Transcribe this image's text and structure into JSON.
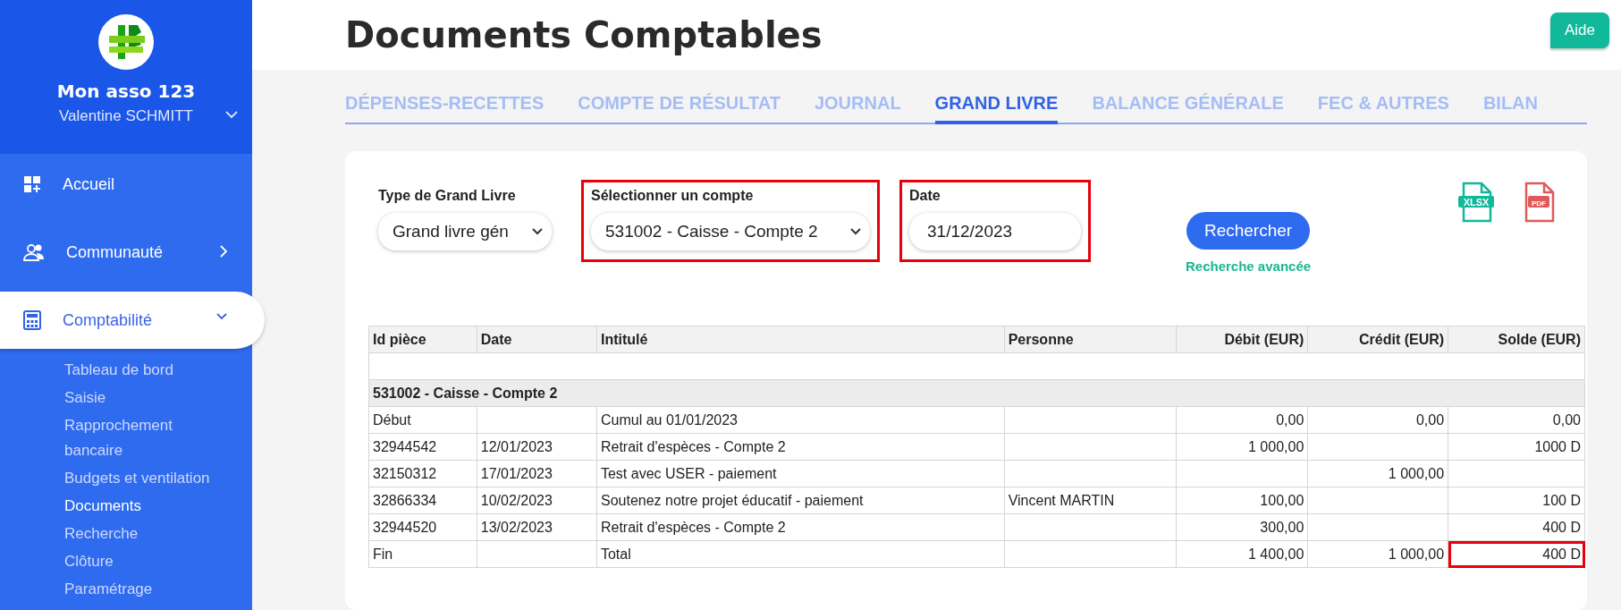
{
  "sidebar": {
    "org_name": "Mon asso 123",
    "user_name": "Valentine SCHMITT",
    "menu": [
      {
        "kind": "link",
        "label": "Accueil",
        "selected": false
      },
      {
        "kind": "group",
        "label": "Communauté",
        "expanded": false,
        "selected": false
      },
      {
        "kind": "group",
        "label": "Comptabilité",
        "expanded": true,
        "selected": true
      }
    ],
    "submenu": [
      {
        "label": "Tableau de bord",
        "selected": false
      },
      {
        "label": "Saisie",
        "selected": false
      },
      {
        "label": "Rapprochement bancaire",
        "selected": false
      },
      {
        "label": "Budgets et ventilation",
        "selected": false
      },
      {
        "label": "Documents",
        "selected": true
      },
      {
        "label": "Recherche",
        "selected": false
      },
      {
        "label": "Clôture",
        "selected": false
      },
      {
        "label": "Paramétrage",
        "selected": false
      }
    ]
  },
  "page_title": "Documents Comptables",
  "help_button": "Aide",
  "tabs": [
    {
      "label": "DÉPENSES-RECETTES",
      "selected": false
    },
    {
      "label": "COMPTE DE RÉSULTAT",
      "selected": false
    },
    {
      "label": "JOURNAL",
      "selected": false
    },
    {
      "label": "GRAND LIVRE",
      "selected": true
    },
    {
      "label": "BALANCE GÉNÉRALE",
      "selected": false
    },
    {
      "label": "FEC & AUTRES",
      "selected": false
    },
    {
      "label": "BILAN",
      "selected": false
    }
  ],
  "filters": [
    {
      "kind": "select",
      "label": "Type de Grand Livre",
      "value": "Grand livre gén",
      "highlighted": false
    },
    {
      "kind": "select",
      "label": "Sélectionner un compte",
      "value": "531002 - Caisse - Compte 2",
      "highlighted": true
    },
    {
      "kind": "date",
      "label": "Date",
      "value": "31/12/2023",
      "highlighted": true
    }
  ],
  "search_button": "Rechercher",
  "advanced_search_link": "Recherche avancée",
  "export_buttons": [
    {
      "kind": "xlsx",
      "label": "XLSX"
    },
    {
      "kind": "pdf",
      "label": "PDF"
    }
  ],
  "table": {
    "columns": [
      "Id pièce",
      "Date",
      "Intitulé",
      "Personne",
      "Débit (EUR)",
      "Crédit (EUR)",
      "Solde (EUR)"
    ],
    "rows": [
      {
        "kind": "group",
        "label": "531002 - Caisse - Compte 2"
      },
      {
        "kind": "data",
        "cells": [
          "Début",
          "",
          "Cumul au 01/01/2023",
          "",
          "0,00",
          "0,00",
          "0,00"
        ],
        "solde_highlighted": false
      },
      {
        "kind": "data",
        "cells": [
          "32944542",
          "12/01/2023",
          "Retrait d'espèces - Compte 2",
          "",
          "1 000,00",
          "",
          "1000 D"
        ],
        "solde_highlighted": false
      },
      {
        "kind": "data",
        "cells": [
          "32150312",
          "17/01/2023",
          "Test avec USER - paiement",
          "",
          "",
          "1 000,00",
          ""
        ],
        "solde_highlighted": false
      },
      {
        "kind": "data",
        "cells": [
          "32866334",
          "10/02/2023",
          "Soutenez notre projet éducatif - paiement",
          "Vincent MARTIN",
          "100,00",
          "",
          "100 D"
        ],
        "solde_highlighted": false
      },
      {
        "kind": "data",
        "cells": [
          "32944520",
          "13/02/2023",
          "Retrait d'espèces - Compte 2",
          "",
          "300,00",
          "",
          "400 D"
        ],
        "solde_highlighted": false
      },
      {
        "kind": "data",
        "cells": [
          "Fin",
          "",
          "Total",
          "",
          "1 400,00",
          "1 000,00",
          "400 D"
        ],
        "solde_highlighted": true
      }
    ]
  }
}
